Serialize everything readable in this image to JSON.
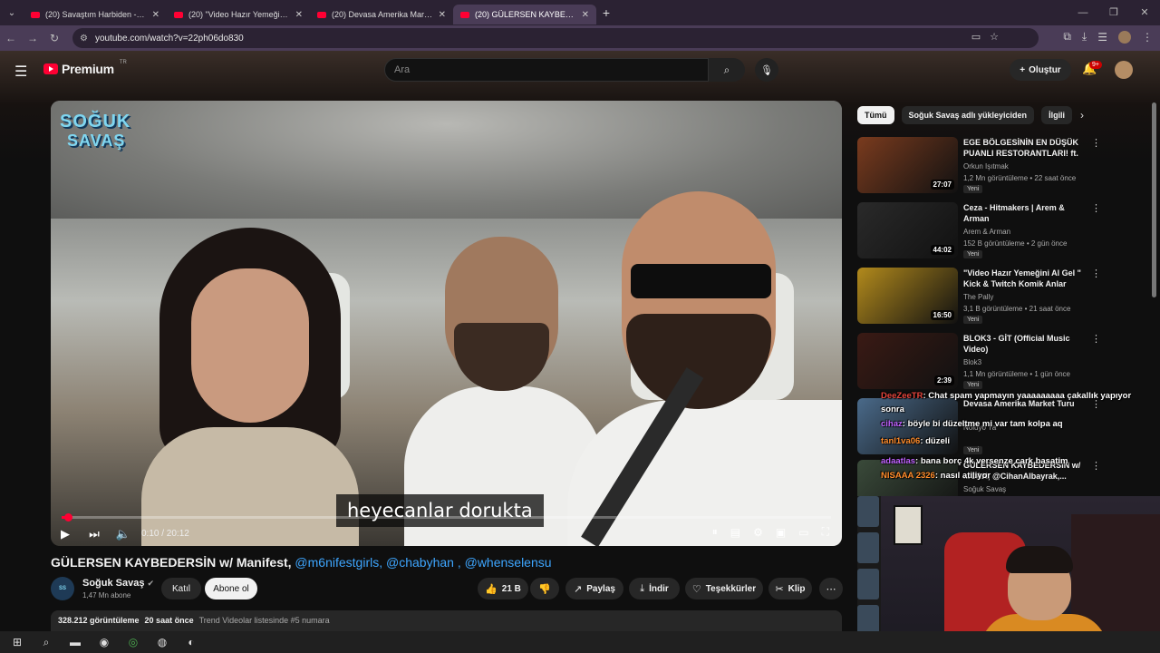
{
  "browser": {
    "tabs": [
      {
        "title": "(20) Savaştım Harbiden - Zeyne",
        "active": false
      },
      {
        "title": "(20) \"Video Hazır Yemeğini Al G",
        "active": false
      },
      {
        "title": "(20) Devasa Amerika Market Tu",
        "active": false
      },
      {
        "title": "(20) GÜLERSEN KAYBEDERSİN w",
        "active": true
      }
    ],
    "new_tab": "+",
    "url": "youtube.com/watch?v=22ph06do830"
  },
  "header": {
    "logo_text": "Premium",
    "logo_region": "TR",
    "search_placeholder": "Ara",
    "create_label": "Oluştur",
    "notifications_badge": "9+"
  },
  "player": {
    "brand_line1": "SOĞUK",
    "brand_line2": "SAVAŞ",
    "subtitle": "heyecanlar dorukta",
    "time": "0:10 / 20:12",
    "progress": 0.008
  },
  "video": {
    "title": "GÜLERSEN KAYBEDERSİN w/ Manifest,",
    "tags": [
      "@m6nifestgirls",
      "@chabyhan",
      "@whenselensu"
    ],
    "channel_name": "Soğuk Savaş",
    "channel_subs": "1,47 Mn abone",
    "join_label": "Katıl",
    "subscribe_label": "Abone ol",
    "likes": "21 B",
    "share_label": "Paylaş",
    "download_label": "İndir",
    "thanks_label": "Teşekkürler",
    "clip_label": "Klip",
    "views": "328.212 görüntüleme",
    "age": "20 saat önce",
    "trending": "Trend Videolar listesinde #5 numara"
  },
  "sidebar": {
    "chips": [
      "Tümü",
      "Soğuk Savaş adlı yükleyiciden",
      "İlgili"
    ],
    "recommendations": [
      {
        "title": "EGE BÖLGESİNİN EN DÜŞÜK PUANLI RESTORANTLARI! ft. ...",
        "channel": "Orkun Işıtmak",
        "meta": "1,2 Mn görüntüleme • 22 saat önce",
        "duration": "27:07",
        "badge": "Yeni",
        "color": "#7a3b1e"
      },
      {
        "title": "Ceza - Hitmakers | Arem & Arman",
        "channel": "Arem & Arman",
        "meta": "152 B görüntüleme • 2 gün önce",
        "duration": "44:02",
        "badge": "Yeni",
        "color": "#2a2a2a"
      },
      {
        "title": "\"Video Hazır Yemeğini Al Gel \" Kick & Twitch Komik Anlar #14...",
        "channel": "The Pally",
        "meta": "3,1 B görüntüleme • 21 saat önce",
        "duration": "16:50",
        "badge": "Yeni",
        "color": "#b28a1c"
      },
      {
        "title": "BLOK3 - GİT (Official Music Video)",
        "channel": "Blok3",
        "meta": "1,1 Mn görüntüleme • 1 gün önce",
        "duration": "2:39",
        "badge": "Yeni",
        "color": "#3a1a14"
      },
      {
        "title": "Devasa Amerika Market Turu",
        "channel": "Noluyo Ya",
        "meta": "",
        "duration": "",
        "badge": "Yeni",
        "color": "#4a6a8a"
      },
      {
        "title": "GÜLERSEN KAYBEDERSİN w/ ...CAN, @CihanAlbayrak,...",
        "channel": "Soğuk Savaş",
        "meta": "",
        "duration": "",
        "badge": "",
        "color": "#3a4a3a"
      }
    ]
  },
  "chat": [
    {
      "user": "DeeZeeTR",
      "message": ": Chat spam yapmayın yaaaaaaaaa çakallık yapıyor",
      "color": "red"
    },
    {
      "user": "",
      "message": "sonra",
      "color": "red"
    },
    {
      "user": "cihaz",
      "message": ": böyle bi düzeltme mi var tam kolpa aq",
      "color": "purple"
    },
    {
      "user": "tanl1va06",
      "message": ": düzeli",
      "color": "orange"
    },
    {
      "user": "adaatlas",
      "message": ": bana borç 4k versenze cark basatim",
      "color": "purple"
    },
    {
      "user": "NISAAA 2326",
      "message": ": nasıl atiliyor",
      "color": "orange"
    }
  ]
}
